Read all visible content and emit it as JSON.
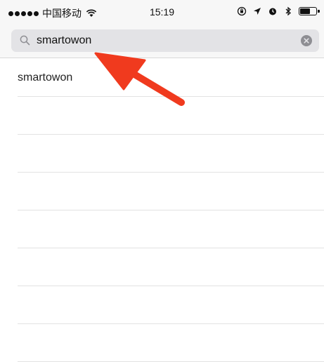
{
  "status_bar": {
    "carrier": "中国移动",
    "time": "15:19",
    "icons": [
      "signal-dots-icon",
      "wifi-icon",
      "rotation-lock-icon",
      "location-icon",
      "alarm-icon",
      "bluetooth-icon",
      "battery-icon"
    ]
  },
  "search": {
    "value": "smartowon",
    "icon": "search-icon",
    "clear_icon": "clear-icon"
  },
  "results": [
    {
      "label": "smartowon"
    },
    {
      "label": ""
    },
    {
      "label": ""
    },
    {
      "label": ""
    },
    {
      "label": ""
    },
    {
      "label": ""
    },
    {
      "label": ""
    },
    {
      "label": ""
    }
  ],
  "annotation": {
    "type": "red-arrow-icon",
    "color": "#f03a1e"
  }
}
